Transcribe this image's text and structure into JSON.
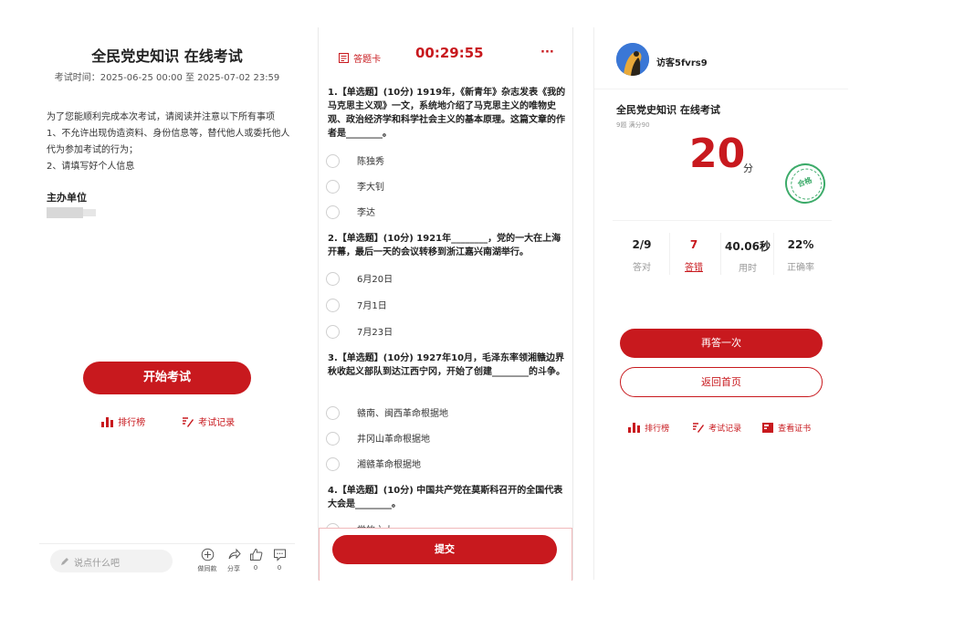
{
  "start_screen": {
    "title": "全民党史知识 在线考试",
    "exam_time": "考试时间：2025-06-25 00:00 至 2025-07-02 23:59",
    "notice_intro": "为了您能顺利完成本次考试，请阅读并注意以下所有事项",
    "notice_1": "1、不允许出现伪造资料、身份信息等，替代他人或委托他人代为参加考试的行为；",
    "notice_2": "2、请填写好个人信息",
    "organizer_label": "主办单位",
    "start_button": "开始考试",
    "rank_link": "排行榜",
    "record_link": "考试记录",
    "comment_placeholder": "说点什么吧",
    "action_same": "做同款",
    "action_share": "分享",
    "like_count": "0",
    "comment_count": "0"
  },
  "exam_screen": {
    "answer_card": "答题卡",
    "timer": "00:29:55",
    "more": "···",
    "questions": [
      {
        "text": "1.【单选题】(10分) 1919年，《新青年》杂志发表《我的马克思主义观》一文，系统地介绍了马克思主义的唯物史观、政治经济学和科学社会主义的基本原理。这篇文章的作者是________。",
        "options": [
          "陈独秀",
          "李大钊",
          "李达"
        ]
      },
      {
        "text": "2.【单选题】(10分) 1921年________，党的一大在上海开幕，最后一天的会议转移到浙江嘉兴南湖举行。",
        "options": [
          "6月20日",
          "7月1日",
          "7月23日"
        ]
      },
      {
        "text": "3.【单选题】(10分) 1927年10月，毛泽东率领湘赣边界秋收起义部队到达江西宁冈，开始了创建________的斗争。",
        "options": [
          "赣南、闽西革命根据地",
          "井冈山革命根据地",
          "湘赣革命根据地"
        ]
      },
      {
        "text": "4.【单选题】(10分) 中国共产党在莫斯科召开的全国代表大会是________。",
        "options": [
          "党的六大"
        ]
      }
    ],
    "submit_button": "提交"
  },
  "result_screen": {
    "username": "访客5fvrs9",
    "exam_title": "全民党史知识 在线考试",
    "meta": "9题  满分90",
    "score": "20",
    "score_unit": "分",
    "stamp": "合格",
    "stats": [
      {
        "value": "2/9",
        "label": "答对"
      },
      {
        "value": "7",
        "label": "答错"
      },
      {
        "value": "40.06秒",
        "label": "用时"
      },
      {
        "value": "22%",
        "label": "正确率"
      }
    ],
    "retry_button": "再答一次",
    "home_button": "返回首页",
    "rank_link": "排行榜",
    "record_link": "考试记录",
    "cert_link": "查看证书"
  },
  "colors": {
    "accent": "#c8191e",
    "stamp": "#3dab6a"
  }
}
